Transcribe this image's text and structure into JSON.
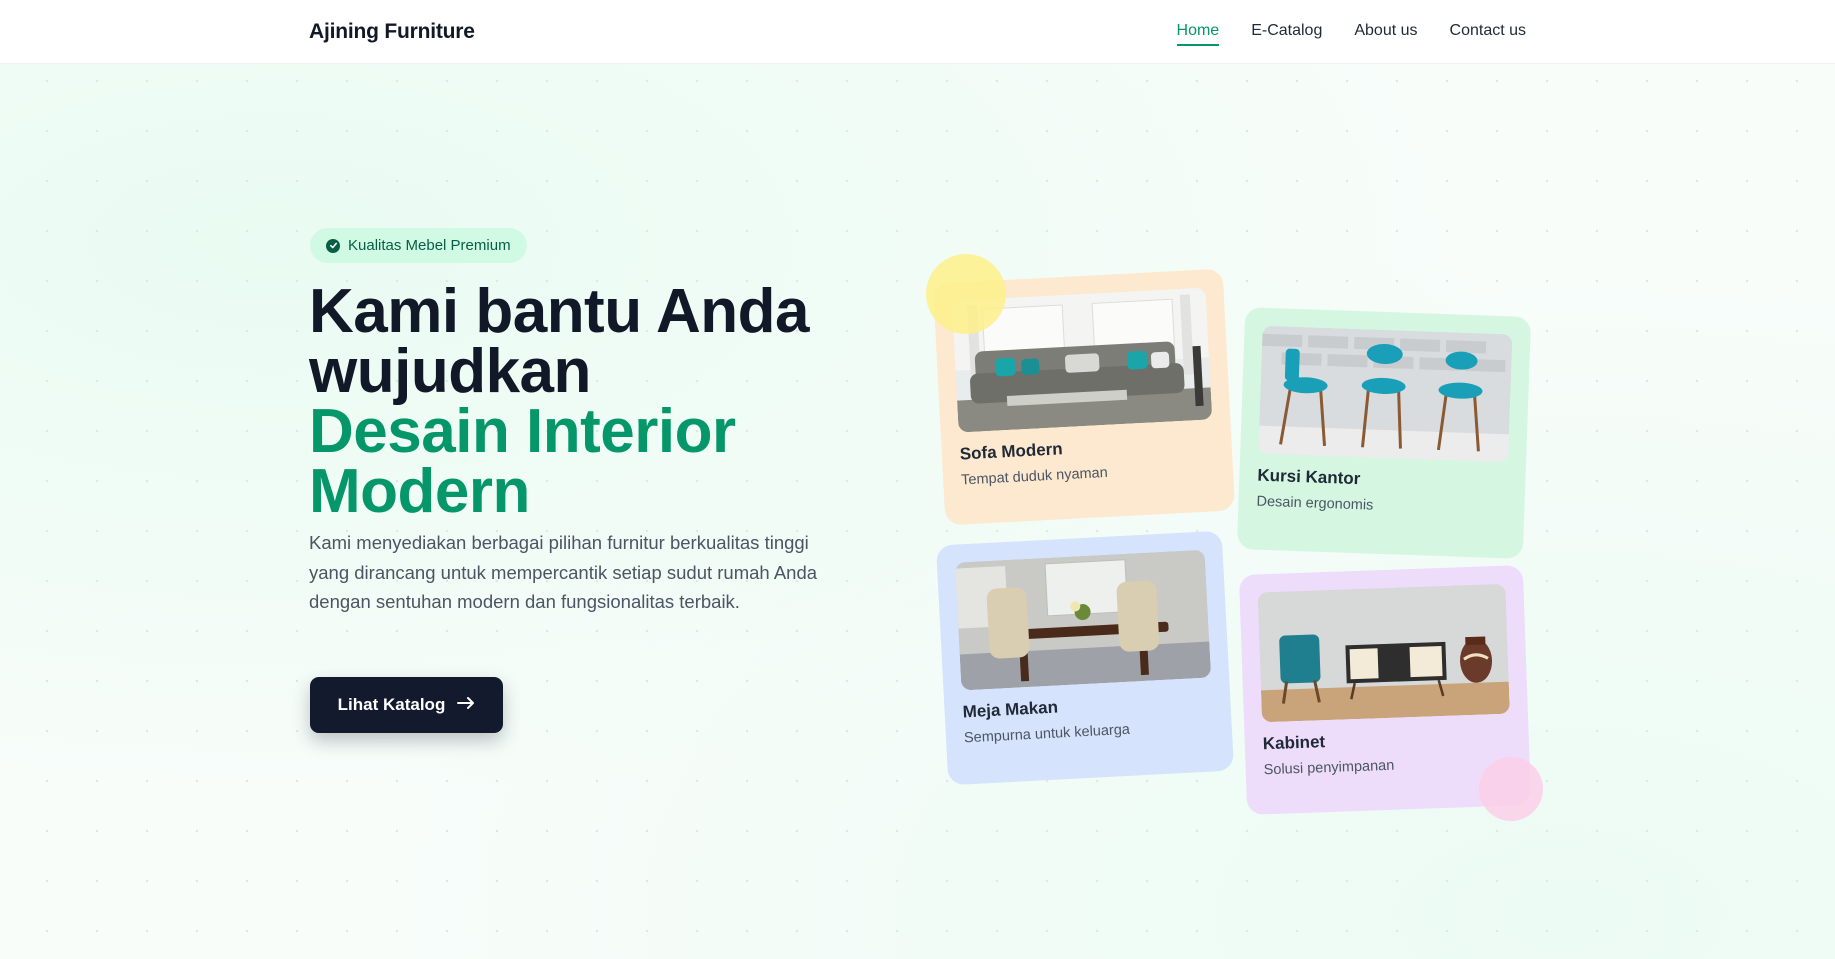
{
  "brand": "Ajining Furniture",
  "nav": [
    {
      "label": "Home",
      "active": true
    },
    {
      "label": "E-Catalog",
      "active": false
    },
    {
      "label": "About us",
      "active": false
    },
    {
      "label": "Contact us",
      "active": false
    }
  ],
  "hero": {
    "badge": {
      "icon": "check-circle-icon",
      "label": "Kualitas Mebel Premium"
    },
    "headline": {
      "line1": "Kami bantu Anda",
      "line2": "wujudkan",
      "line3": "Desain Interior",
      "line4": "Modern"
    },
    "description": "Kami menyediakan berbagai pilihan furnitur berkualitas tinggi yang dirancang untuk mempercantik setiap sudut rumah Anda dengan sentuhan modern dan fungsionalitas terbaik.",
    "cta": {
      "label": "Lihat Katalog",
      "icon": "arrow-right-icon"
    }
  },
  "cards": [
    {
      "title": "Sofa Modern",
      "subtitle": "Tempat duduk nyaman",
      "color": "#fde9cf"
    },
    {
      "title": "Kursi Kantor",
      "subtitle": "Desain ergonomis",
      "color": "#d5f7e1"
    },
    {
      "title": "Meja Makan",
      "subtitle": "Sempurna untuk keluarga",
      "color": "#d5e4fc"
    },
    {
      "title": "Kabinet",
      "subtitle": "Solusi penyimpanan",
      "color": "#eedcfb"
    }
  ],
  "colors": {
    "accent": "#059669",
    "dark": "#141a2e",
    "badge_bg": "#d1fae5"
  }
}
